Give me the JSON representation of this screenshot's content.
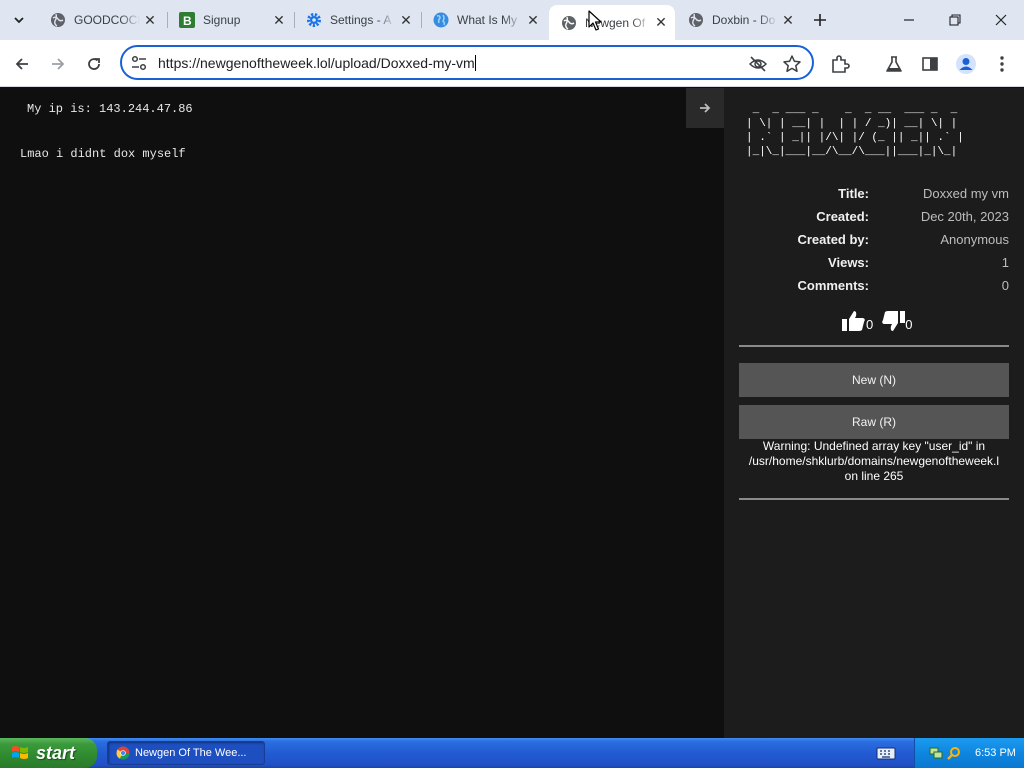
{
  "browser": {
    "tabs": [
      {
        "title": "GOODCOCK",
        "favicon": "globe-icon"
      },
      {
        "title": "Signup",
        "favicon": "b-logo-icon"
      },
      {
        "title": "Settings - A",
        "favicon": "gear-icon"
      },
      {
        "title": "What Is My",
        "favicon": "earth-icon"
      },
      {
        "title": "Newgen Of",
        "favicon": "globe-icon",
        "active": true
      },
      {
        "title": "Doxbin - Do",
        "favicon": "globe-icon"
      }
    ],
    "url": "https://newgenoftheweek.lol/upload/Doxxed-my-vm"
  },
  "paste": {
    "line1": "My ip is: 143.244.47.86",
    "line2": "Lmao i didnt dox myself"
  },
  "sidebar": {
    "ascii_logo": " _  _ ___ _    _  _ __  ___ _  _ \n| \\| | __| |  | | / _)| __| \\| |\n| .` | _|| |/\\| |/ (_ || _|| .` |\n|_|\\_|___|__/\\__/\\___||___|_|\\_|",
    "info": [
      {
        "label": "Title:",
        "value": "Doxxed my vm"
      },
      {
        "label": "Created:",
        "value": "Dec 20th, 2023"
      },
      {
        "label": "Created by:",
        "value": "Anonymous"
      },
      {
        "label": "Views:",
        "value": "1"
      },
      {
        "label": "Comments:",
        "value": "0"
      }
    ],
    "likes": "0",
    "dislikes": "0",
    "new_button": "New (N)",
    "raw_button": "Raw (R)",
    "warning_line1": "Warning: Undefined array key \"user_id\" in",
    "warning_line2": "/usr/home/shklurb/domains/newgenoftheweek.l",
    "warning_line3": "on line 265"
  },
  "taskbar": {
    "start_label": "start",
    "task_title": "Newgen Of The Wee...",
    "clock": "6:53 PM"
  },
  "colors": {
    "accent": "#1a61d6",
    "page_bg": "#0f0f0f",
    "sidebar_bg": "#1c1c1c",
    "button_bg": "#555555"
  }
}
